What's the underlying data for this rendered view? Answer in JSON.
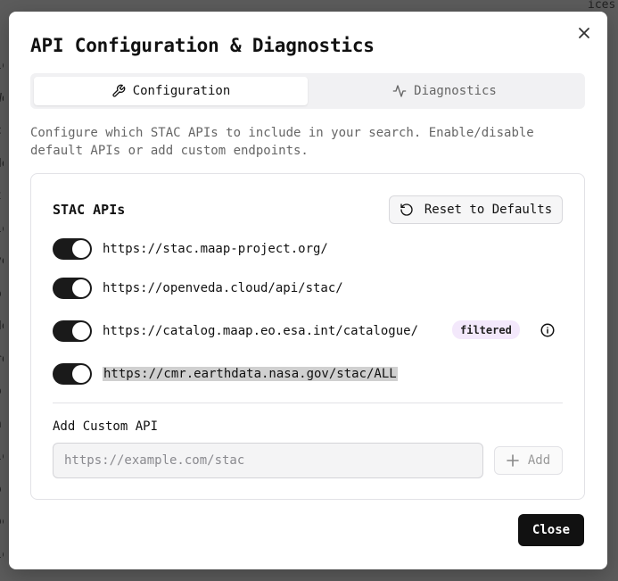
{
  "background": {
    "left_fragments": [
      "ic",
      "We",
      "cr",
      "de",
      "t-",
      "ic",
      "ve",
      "or",
      "de",
      "ro",
      "or",
      "n",
      "ic",
      "or",
      "oc",
      "ic"
    ],
    "right_fragments": [
      "ices",
      "ER",
      "DI",
      "DI",
      "DI",
      "OV",
      "re",
      "ZA",
      "DI",
      "DI",
      "SR",
      "re",
      "S_",
      "lt",
      "DI",
      "A_",
      "B_"
    ]
  },
  "modal": {
    "title": "API Configuration & Diagnostics",
    "close_icon": "close-icon"
  },
  "tabs": [
    {
      "label": "Configuration",
      "icon": "wrench-icon",
      "active": true
    },
    {
      "label": "Diagnostics",
      "icon": "activity-icon",
      "active": false
    }
  ],
  "description": "Configure which STAC APIs to include in your search. Enable/disable default APIs or add custom endpoints.",
  "stac": {
    "title": "STAC APIs",
    "reset_label": "Reset to Defaults",
    "apis": [
      {
        "url": "https://stac.maap-project.org/",
        "enabled": true
      },
      {
        "url": "https://openveda.cloud/api/stac/",
        "enabled": true
      },
      {
        "url": "https://catalog.maap.eo.esa.int/catalogue/",
        "enabled": true,
        "badge": "filtered"
      },
      {
        "url": "https://cmr.earthdata.nasa.gov/stac/ALL",
        "enabled": true
      }
    ]
  },
  "custom": {
    "label": "Add Custom API",
    "placeholder": "https://example.com/stac",
    "add_label": "Add"
  },
  "footer": {
    "close_label": "Close"
  }
}
